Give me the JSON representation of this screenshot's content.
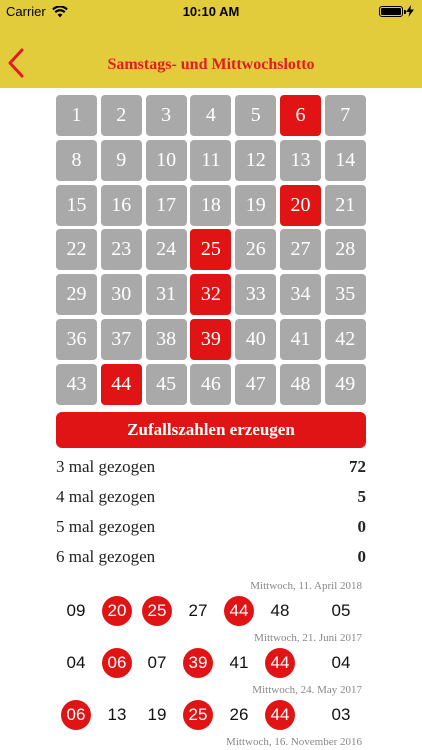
{
  "status_bar": {
    "carrier": "Carrier",
    "time": "10:10 AM"
  },
  "nav": {
    "title": "Samstags- und Mittwochslotto"
  },
  "colors": {
    "accent": "#e01414",
    "header": "#e3cc3c",
    "cell": "#a9a9a9"
  },
  "numbers": [
    "1",
    "2",
    "3",
    "4",
    "5",
    "6",
    "7",
    "8",
    "9",
    "10",
    "11",
    "12",
    "13",
    "14",
    "15",
    "16",
    "17",
    "18",
    "19",
    "20",
    "21",
    "22",
    "23",
    "24",
    "25",
    "26",
    "27",
    "28",
    "29",
    "30",
    "31",
    "32",
    "33",
    "34",
    "35",
    "36",
    "37",
    "38",
    "39",
    "40",
    "41",
    "42",
    "43",
    "44",
    "45",
    "46",
    "47",
    "48",
    "49"
  ],
  "selected": [
    "6",
    "20",
    "25",
    "32",
    "39",
    "44"
  ],
  "generate_button": "Zufallszahlen erzeugen",
  "stats": [
    {
      "label": "3 mal gezogen",
      "value": "72"
    },
    {
      "label": "4 mal gezogen",
      "value": "5"
    },
    {
      "label": "5 mal gezogen",
      "value": "0"
    },
    {
      "label": "6 mal gezogen",
      "value": "0"
    }
  ],
  "draws": [
    {
      "date": "Mittwoch, 11. April 2018",
      "numbers": [
        "09",
        "20",
        "25",
        "27",
        "44",
        "48",
        "05"
      ]
    },
    {
      "date": "Mittwoch, 21. Juni 2017",
      "numbers": [
        "04",
        "06",
        "07",
        "39",
        "41",
        "44",
        "04"
      ]
    },
    {
      "date": "Mittwoch, 24. May 2017",
      "numbers": [
        "06",
        "13",
        "19",
        "25",
        "26",
        "44",
        "03"
      ]
    },
    {
      "date": "Mittwoch, 16. November 2016",
      "numbers": []
    }
  ]
}
